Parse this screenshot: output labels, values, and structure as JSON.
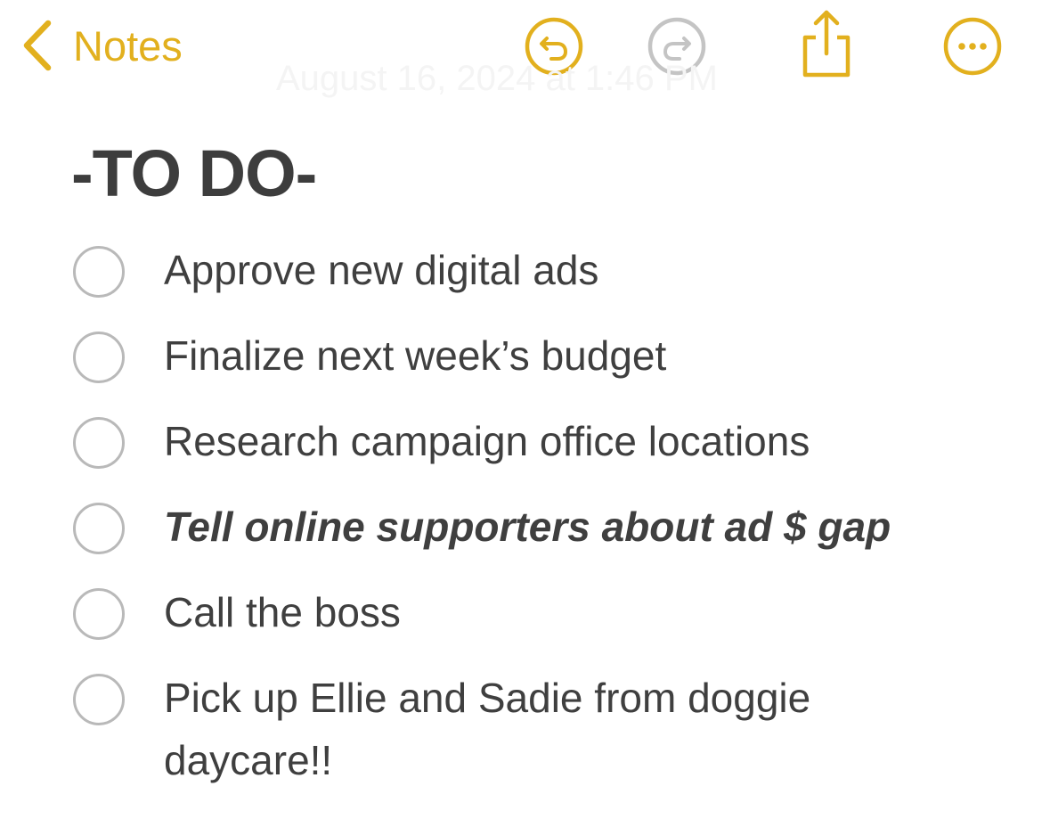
{
  "toolbar": {
    "back_label": "Notes",
    "accent_color": "#E2B01E",
    "icons": [
      "chevron-left-icon",
      "undo-icon",
      "redo-icon",
      "share-icon",
      "more-icon"
    ]
  },
  "note": {
    "timestamp": "August 16, 2024 at 1:46 PM",
    "title": "-TO DO-",
    "items": [
      {
        "text": "Approve new digital ads",
        "checked": false,
        "style": "normal"
      },
      {
        "text": "Finalize next week’s budget",
        "checked": false,
        "style": "normal"
      },
      {
        "text": "Research campaign office locations",
        "checked": false,
        "style": "normal"
      },
      {
        "text": "Tell online supporters about ad $ gap",
        "checked": false,
        "style": "bold-italic"
      },
      {
        "text": "Call the boss",
        "checked": false,
        "style": "normal"
      },
      {
        "text": "Pick up Ellie and Sadie from doggie daycare!!",
        "checked": false,
        "style": "normal"
      }
    ]
  }
}
